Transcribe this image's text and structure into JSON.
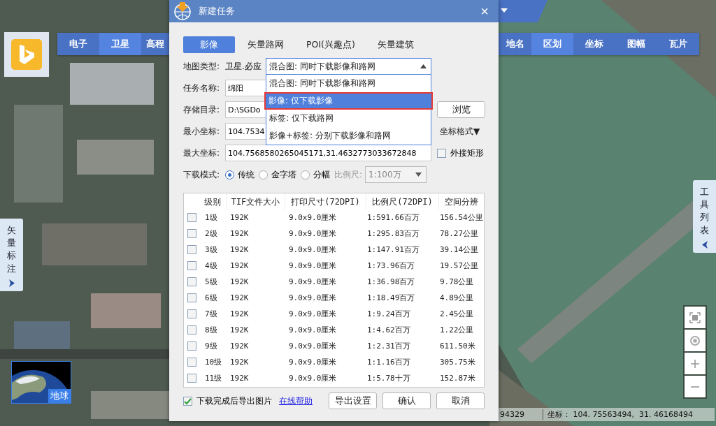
{
  "map": {
    "layer_tabs": [
      {
        "label": "电子",
        "selected": false
      },
      {
        "label": "卫星",
        "selected": true
      },
      {
        "label": "高程",
        "selected": false
      }
    ],
    "tool_tabs": [
      {
        "label": "地名",
        "selected": false
      },
      {
        "label": "区划",
        "selected": true
      },
      {
        "label": "坐标",
        "selected": false
      },
      {
        "label": "图幅",
        "selected": false
      },
      {
        "label": "瓦片",
        "selected": false
      }
    ],
    "left_panel": {
      "label": "矢量标注"
    },
    "right_panel": {
      "label": "工具列表"
    },
    "globe_thumbnail": {
      "label": "地球"
    },
    "status_bar": {
      "scale": "94329",
      "coordinates": "坐标： 104. 75563494,  31. 46168494"
    }
  },
  "dialog": {
    "title": "新建任务",
    "close": "×",
    "tabs": [
      {
        "label": "影像",
        "selected": true
      },
      {
        "label": "矢量路网",
        "selected": false
      },
      {
        "label": "POI(兴趣点)",
        "selected": false
      },
      {
        "label": "矢量建筑",
        "selected": false
      }
    ],
    "map_type": {
      "label": "地图类型:",
      "value": "卫星.必应",
      "dropdown": "混合图: 同时下载影像和路网",
      "expanded": true,
      "options": [
        {
          "label": "混合图: 同时下载影像和路网",
          "selected": false
        },
        {
          "label": "影像: 仅下载影像",
          "selected": true
        },
        {
          "label": "标签: 仅下载路网",
          "selected": false
        },
        {
          "label": "影像+标签: 分别下载影像和路网",
          "selected": false
        }
      ]
    },
    "fields": [
      {
        "kind": "plain",
        "label": "任务名称:",
        "value": "绵阳"
      },
      {
        "kind": "button",
        "label": "存储目录:",
        "value": "D:\\SGDo",
        "action": "浏览"
      },
      {
        "kind": "menu",
        "label": "最小坐标:",
        "value": "104.7534",
        "action": "坐标格式▼"
      },
      {
        "kind": "checkbox",
        "label": "最大坐标:",
        "value": "104.7568580265045171,31.4632773033672848",
        "action": "外接矩形",
        "checked": false
      }
    ],
    "download_mode": {
      "label": "下载模式:",
      "options": [
        {
          "label": "传统",
          "selected": true
        },
        {
          "label": "金字塔",
          "selected": false
        },
        {
          "label": "分幅",
          "selected": false
        }
      ],
      "scale_label": "比例尺:",
      "scale_value": "1:100万",
      "scale_disabled": true
    },
    "table": {
      "columns": [
        "级别",
        "TIF文件大小",
        "打印尺寸(72DPI)",
        "比例尺(72DPI)",
        "空间分辨"
      ],
      "rows": [
        {
          "checked": false,
          "cells": [
            "1级",
            "192K",
            "9.0x9.0厘米",
            "1:591.66百万",
            "156.54公里"
          ]
        },
        {
          "checked": false,
          "cells": [
            "2级",
            "192K",
            "9.0x9.0厘米",
            "1:295.83百万",
            "78.27公里"
          ]
        },
        {
          "checked": false,
          "cells": [
            "3级",
            "192K",
            "9.0x9.0厘米",
            "1:147.91百万",
            "39.14公里"
          ]
        },
        {
          "checked": false,
          "cells": [
            "4级",
            "192K",
            "9.0x9.0厘米",
            "1:73.96百万",
            "19.57公里"
          ]
        },
        {
          "checked": false,
          "cells": [
            "5级",
            "192K",
            "9.0x9.0厘米",
            "1:36.98百万",
            "9.78公里"
          ]
        },
        {
          "checked": false,
          "cells": [
            "6级",
            "192K",
            "9.0x9.0厘米",
            "1:18.49百万",
            "4.89公里"
          ]
        },
        {
          "checked": false,
          "cells": [
            "7级",
            "192K",
            "9.0x9.0厘米",
            "1:9.24百万",
            "2.45公里"
          ]
        },
        {
          "checked": false,
          "cells": [
            "8级",
            "192K",
            "9.0x9.0厘米",
            "1:4.62百万",
            "1.22公里"
          ]
        },
        {
          "checked": false,
          "cells": [
            "9级",
            "192K",
            "9.0x9.0厘米",
            "1:2.31百万",
            "611.50米"
          ]
        },
        {
          "checked": false,
          "cells": [
            "10级",
            "192K",
            "9.0x9.0厘米",
            "1:1.16百万",
            "305.75米"
          ]
        },
        {
          "checked": false,
          "cells": [
            "11级",
            "192K",
            "9.0x9.0厘米",
            "1:5.78十万",
            "152.87米"
          ]
        }
      ]
    },
    "export_after": {
      "label": "下载完成后导出图片",
      "checked": true
    },
    "help_link": "在线帮助",
    "buttons": [
      "导出设置",
      "确认",
      "取消"
    ]
  }
}
